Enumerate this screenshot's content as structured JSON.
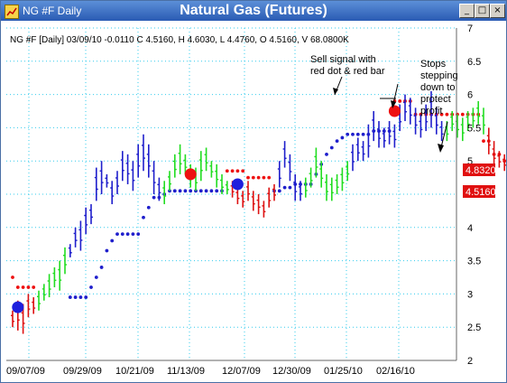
{
  "window": {
    "title": "NG #F Daily",
    "chart_title": "Natural Gas (Futures)",
    "icon": "chart-icon",
    "controls": [
      "_",
      "□",
      "×"
    ]
  },
  "info_line": "NG #F [Daily] 03/09/10 -0.0110 C 4.5160, H 4.6030, L 4.4760, O 4.5160, V 68.0800K",
  "annotations": {
    "sell_signal": [
      "Sell signal with",
      "red dot & red bar"
    ],
    "stops": [
      "Stops",
      "stepping",
      "down to",
      "protect",
      "profit"
    ]
  },
  "price_labels": {
    "stop": "4.8320",
    "close": "4.5160"
  },
  "colors": {
    "up_trend_bar": "#1f1fcc",
    "neutral_bar": "#22dd22",
    "down_trend_bar": "#dd1111",
    "buy_stop_dots": "#1f1fcc",
    "sell_stop_dots": "#ee1111",
    "grid": "#33ccee",
    "price_label_bg": "#e01010"
  },
  "chart_data": {
    "type": "ohlc-bar",
    "title": "Natural Gas (Futures)",
    "y_axis": {
      "position": "right",
      "ylim": [
        2,
        7
      ],
      "ticks": [
        "2",
        "2.5",
        "3",
        "3.5",
        "4",
        "4.5",
        "5",
        "5.5",
        "6",
        "6.5",
        "7"
      ]
    },
    "x_axis": {
      "tick_labels": [
        "09/07/09",
        "09/29/09",
        "10/21/09",
        "11/13/09",
        "12/07/09",
        "12/30/09",
        "01/25/10",
        "02/16/10"
      ]
    },
    "grid": true,
    "series": [
      {
        "segment": "red",
        "bars": [
          [
            2.75,
            2.5
          ],
          [
            2.9,
            2.45
          ],
          [
            2.85,
            2.4
          ],
          [
            3.0,
            2.65
          ],
          [
            2.95,
            2.7
          ]
        ]
      },
      {
        "segment": "green",
        "bars": [
          [
            3.05,
            2.75
          ],
          [
            3.15,
            2.9
          ],
          [
            3.3,
            2.95
          ],
          [
            3.4,
            3.1
          ],
          [
            3.5,
            3.05
          ],
          [
            3.7,
            3.3
          ]
        ]
      },
      {
        "segment": "blue",
        "bars": [
          [
            3.75,
            3.55
          ],
          [
            4.0,
            3.7
          ],
          [
            4.1,
            3.65
          ],
          [
            4.3,
            3.9
          ],
          [
            4.35,
            4.05
          ],
          [
            4.9,
            4.4
          ],
          [
            5.0,
            4.5
          ],
          [
            4.8,
            4.6
          ],
          [
            4.7,
            4.35
          ],
          [
            4.85,
            4.5
          ],
          [
            5.15,
            4.7
          ],
          [
            5.1,
            4.65
          ],
          [
            5.0,
            4.55
          ],
          [
            5.25,
            4.75
          ],
          [
            5.4,
            4.85
          ],
          [
            5.25,
            4.75
          ],
          [
            5.0,
            4.5
          ],
          [
            4.75,
            4.4
          ]
        ]
      },
      {
        "segment": "green",
        "bars": [
          [
            4.7,
            4.35
          ],
          [
            4.85,
            4.55
          ],
          [
            5.1,
            4.75
          ],
          [
            5.25,
            4.8
          ],
          [
            5.1,
            4.8
          ],
          [
            4.95,
            4.6
          ],
          [
            4.9,
            4.55
          ],
          [
            5.15,
            4.7
          ],
          [
            5.2,
            4.85
          ],
          [
            5.0,
            4.75
          ],
          [
            4.95,
            4.6
          ],
          [
            4.8,
            4.5
          ],
          [
            4.7,
            4.5
          ]
        ]
      },
      {
        "segment": "red",
        "bars": [
          [
            4.7,
            4.45
          ],
          [
            4.6,
            4.35
          ],
          [
            4.55,
            4.3
          ],
          [
            4.7,
            4.4
          ],
          [
            4.55,
            4.25
          ],
          [
            4.5,
            4.2
          ],
          [
            4.4,
            4.15
          ],
          [
            4.6,
            4.3
          ],
          [
            4.65,
            4.4
          ]
        ]
      },
      {
        "segment": "blue",
        "bars": [
          [
            5.0,
            4.6
          ],
          [
            5.3,
            4.9
          ],
          [
            5.1,
            4.7
          ],
          [
            4.8,
            4.4
          ],
          [
            4.7,
            4.4
          ]
        ]
      },
      {
        "segment": "green",
        "bars": [
          [
            4.75,
            4.45
          ],
          [
            4.9,
            4.6
          ],
          [
            5.2,
            4.75
          ],
          [
            5.0,
            4.6
          ],
          [
            4.8,
            4.4
          ],
          [
            4.75,
            4.4
          ],
          [
            4.8,
            4.5
          ],
          [
            4.9,
            4.55
          ],
          [
            5.0,
            4.7
          ]
        ]
      },
      {
        "segment": "blue",
        "bars": [
          [
            5.25,
            4.85
          ],
          [
            5.35,
            5.0
          ],
          [
            5.3,
            5.0
          ],
          [
            5.55,
            5.05
          ],
          [
            5.75,
            5.3
          ],
          [
            5.6,
            5.2
          ],
          [
            5.5,
            5.2
          ],
          [
            5.6,
            5.25
          ],
          [
            5.55,
            5.2
          ],
          [
            5.85,
            5.45
          ],
          [
            6.0,
            5.6
          ],
          [
            5.95,
            5.55
          ],
          [
            5.8,
            5.4
          ],
          [
            5.7,
            5.35
          ],
          [
            5.85,
            5.45
          ],
          [
            6.05,
            5.5
          ],
          [
            5.8,
            5.4
          ],
          [
            5.6,
            5.3
          ]
        ]
      },
      {
        "segment": "green",
        "bars": [
          [
            5.6,
            5.3
          ],
          [
            5.75,
            5.45
          ],
          [
            5.7,
            5.35
          ],
          [
            5.65,
            5.3
          ],
          [
            5.75,
            5.45
          ],
          [
            5.8,
            5.5
          ],
          [
            5.9,
            5.55
          ],
          [
            5.8,
            5.4
          ]
        ]
      },
      {
        "segment": "red",
        "bars": [
          [
            5.5,
            5.1
          ],
          [
            5.3,
            4.9
          ],
          [
            5.15,
            4.9
          ],
          [
            5.1,
            4.85
          ]
        ]
      },
      {
        "segment": "green",
        "bars": [
          [
            5.35,
            5.05
          ],
          [
            5.5,
            5.2
          ],
          [
            5.45,
            5.1
          ],
          [
            5.3,
            5.0
          ],
          [
            5.4,
            5.05
          ],
          [
            5.35,
            5.0
          ],
          [
            5.5,
            5.15
          ],
          [
            5.4,
            5.05
          ]
        ]
      },
      {
        "segment": "red",
        "bars": [
          [
            5.3,
            5.0
          ],
          [
            5.2,
            4.9
          ],
          [
            5.0,
            4.75
          ],
          [
            4.9,
            4.65
          ],
          [
            4.85,
            4.6
          ],
          [
            4.9,
            4.6
          ],
          [
            4.8,
            4.55
          ],
          [
            4.75,
            4.5
          ],
          [
            4.7,
            4.45
          ],
          [
            4.6,
            4.5
          ]
        ]
      }
    ],
    "stop_dots": [
      {
        "color": "red",
        "levels": [
          3.25,
          3.1,
          3.1,
          3.1,
          3.1
        ]
      },
      {
        "color": "blue",
        "levels": [
          null,
          null,
          null,
          null,
          null,
          null,
          2.95,
          2.95,
          2.95,
          2.95,
          3.1,
          3.25,
          3.4,
          3.65,
          3.8,
          3.9,
          3.9,
          3.9,
          3.9,
          3.9,
          4.15,
          4.3,
          4.45,
          4.45,
          4.5,
          4.55,
          4.55,
          4.55,
          4.55,
          4.55,
          4.55,
          4.55,
          4.55,
          4.55,
          4.55,
          4.55
        ]
      },
      {
        "color": "red",
        "levels": [
          4.85,
          4.85,
          4.85,
          4.85,
          4.75,
          4.75,
          4.75,
          4.75,
          4.75
        ]
      },
      {
        "color": "blue",
        "levels": [
          4.55,
          4.55,
          4.6,
          4.6,
          4.65,
          4.65,
          4.65,
          4.65,
          4.8,
          4.95,
          5.1,
          5.2,
          5.3,
          5.35,
          5.4,
          5.4,
          5.4,
          5.4,
          5.4,
          5.45,
          5.45,
          5.45,
          5.45
        ]
      },
      {
        "color": "red",
        "levels": [
          5.9,
          5.9,
          5.9,
          5.9,
          5.7,
          5.7,
          5.7,
          5.7,
          5.7,
          5.7,
          5.7,
          5.7,
          5.7,
          5.7,
          5.7,
          5.7,
          5.7,
          5.3,
          5.3,
          5.1,
          5.1,
          5.0,
          4.95,
          4.9,
          4.83
        ]
      }
    ],
    "signals": [
      {
        "type": "buy",
        "x_index": 1,
        "y": 2.8,
        "color": "blue"
      },
      {
        "type": "sell",
        "x_index": 34,
        "y": 4.8,
        "color": "red"
      },
      {
        "type": "buy",
        "x_index": 43,
        "y": 4.65,
        "color": "blue"
      },
      {
        "type": "sell",
        "x_index": 73,
        "y": 5.75,
        "color": "red"
      }
    ],
    "price_markers": [
      {
        "label": "4.8320",
        "y": 4.832
      },
      {
        "label": "4.5160",
        "y": 4.516
      }
    ]
  }
}
